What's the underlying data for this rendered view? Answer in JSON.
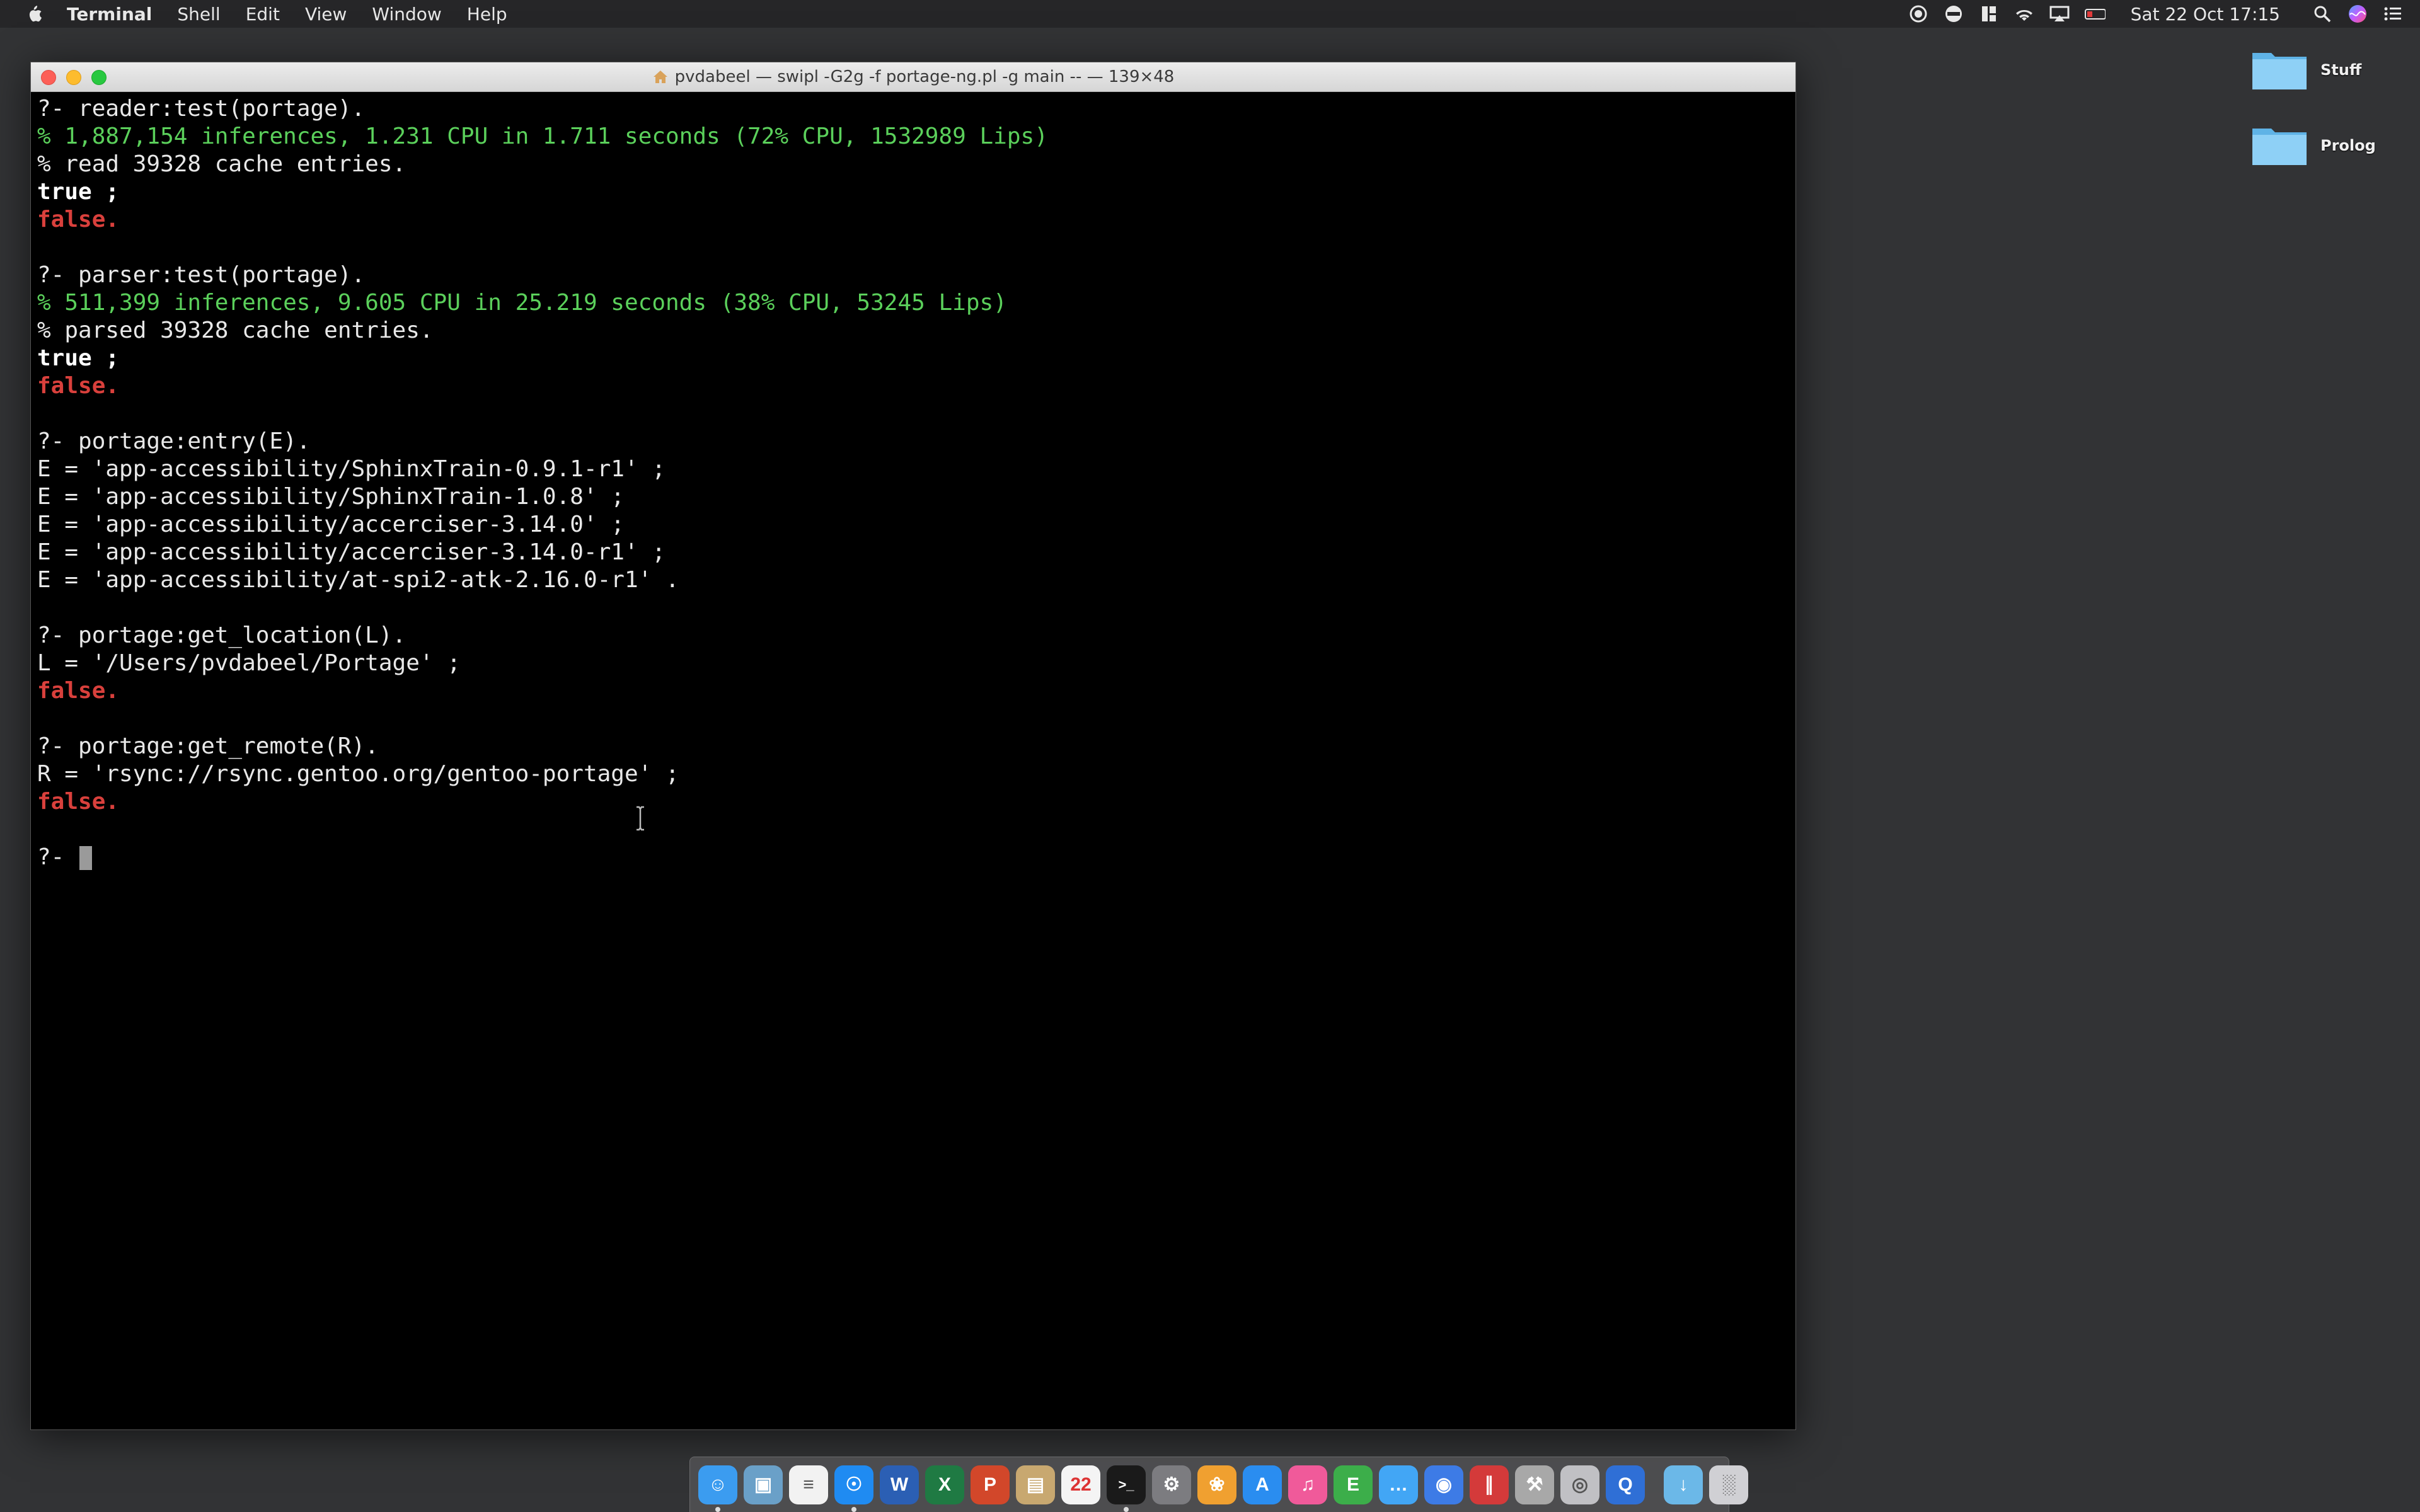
{
  "menubar": {
    "app_name": "Terminal",
    "items": [
      "Shell",
      "Edit",
      "View",
      "Window",
      "Help"
    ],
    "clock": "Sat 22 Oct  17:15",
    "status_icons": [
      "screen-record-icon",
      "circle-icon",
      "panel-icon",
      "wifi-icon",
      "airplay-icon",
      "battery-icon",
      "spotlight-icon",
      "siri-icon",
      "notification-list-icon"
    ]
  },
  "desktop": {
    "icons": [
      {
        "label": "Stuff"
      },
      {
        "label": "Prolog"
      }
    ]
  },
  "terminal": {
    "title": "pvdabeel — swipl -G2g -f portage-ng.pl -g main -- — 139×48",
    "lines": [
      {
        "text": "?- reader:test(portage).",
        "style": "prompt"
      },
      {
        "text": "% 1,887,154 inferences, 1.231 CPU in 1.711 seconds (72% CPU, 1532989 Lips)",
        "style": "green"
      },
      {
        "text": "% read 39328 cache entries.",
        "style": "normal"
      },
      {
        "text": "true ;",
        "style": "bold"
      },
      {
        "text": "false.",
        "style": "red"
      },
      {
        "text": "",
        "style": "normal"
      },
      {
        "text": "?- parser:test(portage).",
        "style": "prompt"
      },
      {
        "text": "% 511,399 inferences, 9.605 CPU in 25.219 seconds (38% CPU, 53245 Lips)",
        "style": "green"
      },
      {
        "text": "% parsed 39328 cache entries.",
        "style": "normal"
      },
      {
        "text": "true ;",
        "style": "bold"
      },
      {
        "text": "false.",
        "style": "red"
      },
      {
        "text": "",
        "style": "normal"
      },
      {
        "text": "?- portage:entry(E).",
        "style": "prompt"
      },
      {
        "text": "E = 'app-accessibility/SphinxTrain-0.9.1-r1' ;",
        "style": "normal"
      },
      {
        "text": "E = 'app-accessibility/SphinxTrain-1.0.8' ;",
        "style": "normal"
      },
      {
        "text": "E = 'app-accessibility/accerciser-3.14.0' ;",
        "style": "normal"
      },
      {
        "text": "E = 'app-accessibility/accerciser-3.14.0-r1' ;",
        "style": "normal"
      },
      {
        "text": "E = 'app-accessibility/at-spi2-atk-2.16.0-r1' .",
        "style": "normal"
      },
      {
        "text": "",
        "style": "normal"
      },
      {
        "text": "?- portage:get_location(L).",
        "style": "prompt"
      },
      {
        "text": "L = '/Users/pvdabeel/Portage' ;",
        "style": "normal"
      },
      {
        "text": "false.",
        "style": "red"
      },
      {
        "text": "",
        "style": "normal"
      },
      {
        "text": "?- portage:get_remote(R).",
        "style": "prompt"
      },
      {
        "text": "R = 'rsync://rsync.gentoo.org/gentoo-portage' ;",
        "style": "normal"
      },
      {
        "text": "false.",
        "style": "red"
      },
      {
        "text": "",
        "style": "normal"
      }
    ],
    "current_prompt": "?- "
  },
  "dock": {
    "apps": [
      {
        "name": "finder-icon",
        "color": "#3b9cf0",
        "running": true
      },
      {
        "name": "preview-icon",
        "color": "#6aa0c8",
        "running": false
      },
      {
        "name": "textedit-icon",
        "color": "#f2f2f2",
        "running": false
      },
      {
        "name": "safari-icon",
        "color": "#1f8bf2",
        "running": true
      },
      {
        "name": "word-icon",
        "color": "#2b5fb4",
        "running": false
      },
      {
        "name": "excel-icon",
        "color": "#1f7a43",
        "running": false
      },
      {
        "name": "powerpoint-icon",
        "color": "#d2472a",
        "running": false
      },
      {
        "name": "notebook-icon",
        "color": "#c8a870",
        "running": false
      },
      {
        "name": "calendar-icon",
        "color": "#f4f4f4",
        "running": false
      },
      {
        "name": "terminal-icon",
        "color": "#1a1a1a",
        "running": true
      },
      {
        "name": "system-preferences-icon",
        "color": "#7c7c80",
        "running": false
      },
      {
        "name": "photos-icon",
        "color": "#f0a030",
        "running": false
      },
      {
        "name": "app-store-icon",
        "color": "#2a8df0",
        "running": false
      },
      {
        "name": "itunes-icon",
        "color": "#f05a9a",
        "running": false
      },
      {
        "name": "evernote-icon",
        "color": "#3cae4a",
        "running": false
      },
      {
        "name": "messages-icon",
        "color": "#42a6f5",
        "running": false
      },
      {
        "name": "notifications-icon",
        "color": "#3d7be6",
        "running": false
      },
      {
        "name": "parallels-icon",
        "color": "#d43a3a",
        "running": false
      },
      {
        "name": "utility-icon",
        "color": "#a8a8a8",
        "running": false
      },
      {
        "name": "disk-utility-icon",
        "color": "#c0c0c4",
        "running": false
      },
      {
        "name": "quicktime-icon",
        "color": "#2f6fd6",
        "running": false
      }
    ],
    "trailing": [
      {
        "name": "downloads-folder-icon",
        "color": "#6bb8e8"
      },
      {
        "name": "trash-icon",
        "color": "#d0d0d4"
      }
    ]
  }
}
